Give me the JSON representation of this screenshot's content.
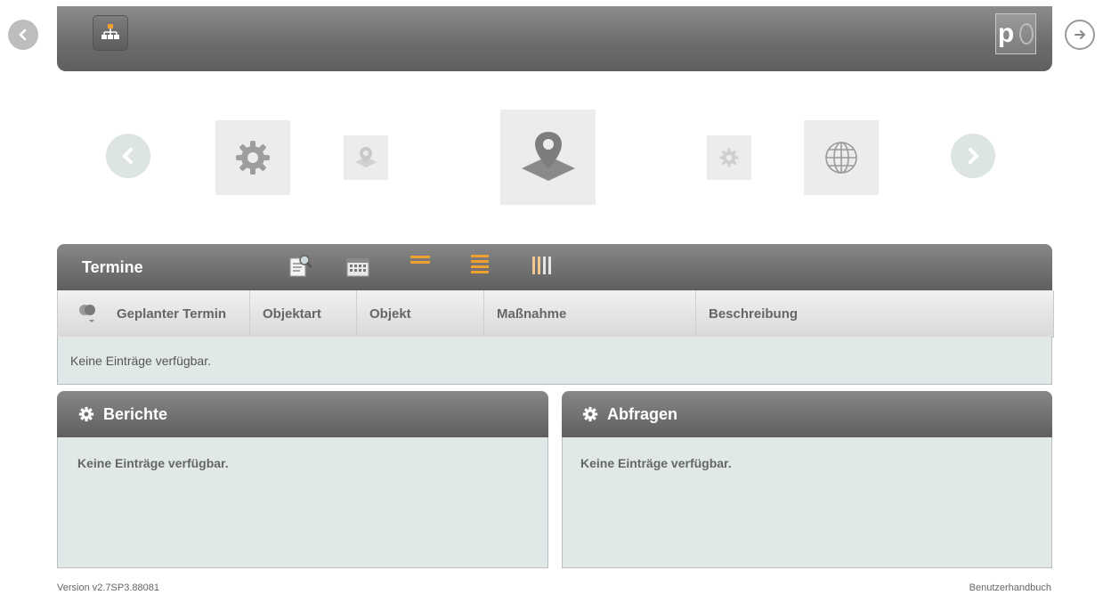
{
  "header": {
    "back_icon": "chevron-left-icon",
    "app_icon": "org-chart-icon",
    "logo_text": "p",
    "logout_icon": "logout-icon"
  },
  "carousel": {
    "items": [
      "gear-icon",
      "map-marker-icon",
      "map-marker-icon",
      "gear-icon",
      "globe-icon"
    ]
  },
  "termine": {
    "title": "Termine",
    "toolbar_icons": [
      "search-document-icon",
      "calendar-icon",
      "list-icon",
      "lines-icon",
      "columns-icon"
    ],
    "columns": [
      "Geplanter Termin",
      "Objektart",
      "Objekt",
      "Maßnahme",
      "Beschreibung"
    ],
    "empty_text": "Keine Einträge verfügbar."
  },
  "berichte": {
    "title": "Berichte",
    "empty_text": "Keine Einträge verfügbar."
  },
  "abfragen": {
    "title": "Abfragen",
    "empty_text": "Keine Einträge verfügbar."
  },
  "footer": {
    "version": "Version v2.7SP3.88081",
    "manual_link": "Benutzerhandbuch"
  },
  "colors": {
    "header_dark": "#5f5f5f",
    "accent_orange": "#f0a030",
    "panel_body": "#e1e8e8"
  }
}
